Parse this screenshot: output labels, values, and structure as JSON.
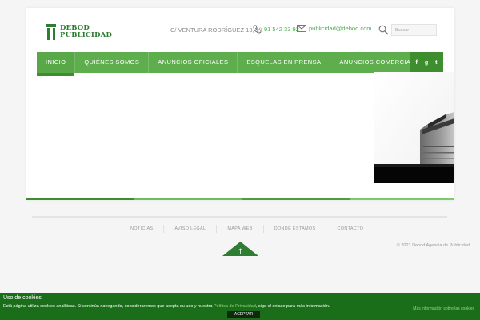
{
  "brand": {
    "line1": "DEBOD",
    "line2": "PUBLICIDAD",
    "color": "#2e7d32"
  },
  "header": {
    "address": "C/ VENTURA RODRÍGUEZ 13, 1º",
    "phone": "91 542 33 92",
    "email": "publicidad@debod.com",
    "search_placeholder": "Buscar",
    "phone_icon": "phone-icon",
    "email_icon": "envelope-icon",
    "search_icon": "magnifier-icon"
  },
  "nav": {
    "items": [
      "INICIO",
      "QUIÉNES SOMOS",
      "ANUNCIOS OFICIALES",
      "ESQUELAS EN PRENSA",
      "ANUNCIOS COMERCIALES"
    ],
    "active_index": 0,
    "social": [
      "f",
      "g",
      "t"
    ],
    "social_icons": [
      "facebook-icon",
      "google-plus-icon",
      "twitter-icon"
    ],
    "colors": {
      "bar": "#5fae4e",
      "social_bg": "#3e8e2f"
    }
  },
  "footer": {
    "links": [
      "NOTICIAS",
      "AVISO LEGAL",
      "MAPA WEB",
      "DÓNDE ESTAMOS",
      "CONTACTO"
    ],
    "copyright": "© 2021 Debod Agencia de Publicidad",
    "to_top_icon": "arrow-up-icon"
  },
  "cookie": {
    "title": "Uso de cookies",
    "text_before": "Está página utiliza cookies analíticas. Si continúa navegando, consideraremos que acepta su uso y nuestra ",
    "link": "Política de Privacidad",
    "text_after": ", siga el enlace para más información.",
    "more": "Más información sobre las cookies",
    "accept": "ACEPTAR",
    "bg_color": "#1a6e1a"
  }
}
